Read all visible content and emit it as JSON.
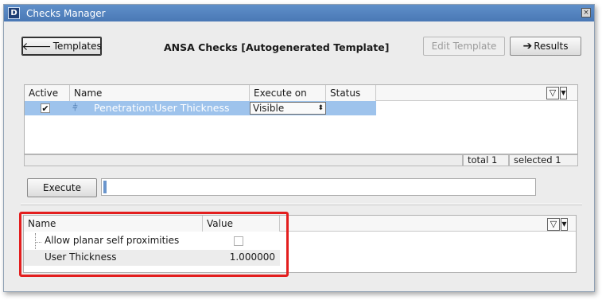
{
  "window": {
    "title": "Checks Manager",
    "app_icon": "D",
    "close_glyph": "×"
  },
  "toolbar": {
    "templates_label": "Templates",
    "template_title": "ANSA Checks [Autogenerated Template]",
    "edit_template_label": "Edit Template",
    "results_label": "Results"
  },
  "checks_table": {
    "columns": [
      "Active",
      "Name",
      "Execute on",
      "Status"
    ],
    "rows": [
      {
        "active": true,
        "name": "Penetration:User Thickness",
        "execute_on": "Visible",
        "status": ""
      }
    ]
  },
  "status": {
    "total": "total 1",
    "selected": "selected 1"
  },
  "execute": {
    "label": "Execute",
    "progress": 0
  },
  "params_table": {
    "columns": [
      "Name",
      "Value"
    ],
    "rows": [
      {
        "name": "Allow planar self proximities",
        "value": "",
        "type": "checkbox",
        "checked": false
      },
      {
        "name": "User Thickness",
        "value": "1.000000",
        "type": "number"
      }
    ]
  },
  "icons": {
    "arrow_left": "🡐",
    "arrow_right": "➔",
    "filter": "▽",
    "dropdown": "▼",
    "spin": "⬍",
    "check": "✔",
    "check_icon": "⫩"
  },
  "colors": {
    "selection": "#9ec3ec",
    "highlight_border": "#e31e1e",
    "titlebar": "#4f7fbc"
  }
}
